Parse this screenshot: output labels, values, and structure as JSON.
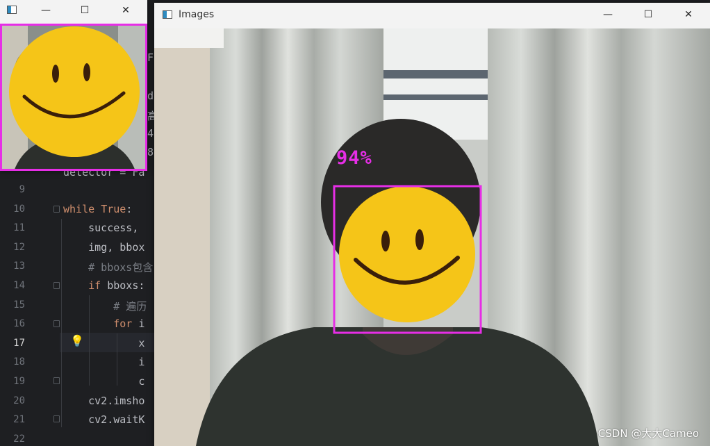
{
  "editor": {
    "line_numbers": [
      "9",
      "10",
      "11",
      "12",
      "13",
      "14",
      "15",
      "16",
      "17",
      "18",
      "19",
      "20",
      "21",
      "22"
    ],
    "current_line": "17",
    "partial_top": "detector = Fa",
    "lines": [
      {
        "tokens": [
          {
            "t": "",
            "c": ""
          }
        ]
      },
      {
        "tokens": [
          {
            "t": "while ",
            "c": "kw"
          },
          {
            "t": "True",
            "c": "kw"
          },
          {
            "t": ":",
            "c": ""
          }
        ]
      },
      {
        "tokens": [
          {
            "t": "    success, ",
            "c": ""
          }
        ]
      },
      {
        "tokens": [
          {
            "t": "    img, bbox",
            "c": ""
          }
        ]
      },
      {
        "tokens": [
          {
            "t": "    # bboxs包含",
            "c": "cm"
          }
        ]
      },
      {
        "tokens": [
          {
            "t": "    ",
            "c": ""
          },
          {
            "t": "if ",
            "c": "kw"
          },
          {
            "t": "bboxs:",
            "c": ""
          }
        ]
      },
      {
        "tokens": [
          {
            "t": "        # 遍历",
            "c": "cm"
          }
        ]
      },
      {
        "tokens": [
          {
            "t": "        ",
            "c": ""
          },
          {
            "t": "for ",
            "c": "kw"
          },
          {
            "t": "i",
            "c": ""
          }
        ]
      },
      {
        "tokens": [
          {
            "t": "            x",
            "c": ""
          }
        ]
      },
      {
        "tokens": [
          {
            "t": "            i",
            "c": ""
          }
        ]
      },
      {
        "tokens": [
          {
            "t": "            c",
            "c": ""
          }
        ]
      },
      {
        "tokens": [
          {
            "t": "    cv2.imsho",
            "c": ""
          }
        ]
      },
      {
        "tokens": [
          {
            "t": "    cv2.waitK",
            "c": ""
          }
        ]
      },
      {
        "tokens": [
          {
            "t": "",
            "c": ""
          }
        ]
      }
    ],
    "peek_chars": [
      "F",
      "d",
      "高",
      "4",
      "8"
    ]
  },
  "small_window": {
    "title": "",
    "controls": {
      "minimize": "—",
      "maximize": "☐",
      "close": "✕"
    }
  },
  "images_window": {
    "title": "Images",
    "controls": {
      "minimize": "—",
      "maximize": "☐",
      "close": "✕"
    },
    "confidence_label": "94%",
    "watermark": "CSDN @大大Cameo"
  },
  "colors": {
    "bbox": "#e62ee6",
    "emoji_face": "#f5c518",
    "emoji_features": "#3a1f0a",
    "editor_bg": "#1e1f22",
    "keyword": "#cf8e6d"
  }
}
